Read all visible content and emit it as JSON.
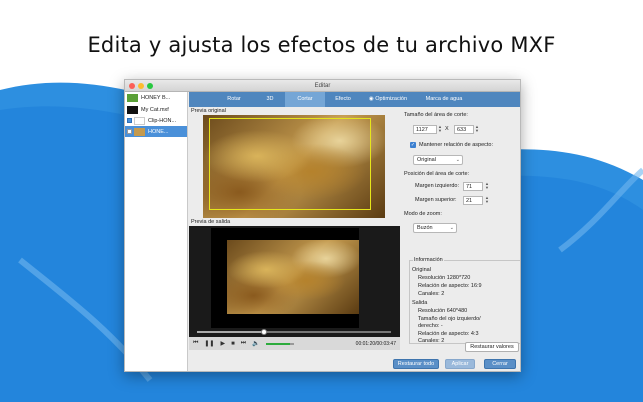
{
  "headline": "Edita y ajusta los efectos de tu archivo MXF",
  "window": {
    "title": "Editar",
    "files": [
      {
        "name": "HONEY B...",
        "checked": false,
        "selected": false
      },
      {
        "name": "My Cat.mxf",
        "checked": false,
        "selected": false
      },
      {
        "name": "Clip-HON...",
        "checked": true,
        "selected": false
      },
      {
        "name": "HONE...",
        "checked": false,
        "selected": true
      }
    ],
    "tabs": [
      "Rotar",
      "3D",
      "Cortar",
      "Efecto",
      "Optimización",
      "Marca de agua"
    ],
    "active_tab": "Cortar",
    "preview_original_label": "Previa original",
    "preview_output_label": "Previa de salida",
    "time_display": "00:01:20/00:03:47",
    "crop": {
      "size_label": "Tamaño del área de corte:",
      "width": "1127",
      "x_sep": "X",
      "height": "633",
      "keep_ratio_label": "Mantener relación de aspecto:",
      "keep_ratio_checked": true,
      "ratio_option": "Original",
      "position_label": "Posición del área de corte:",
      "margin_left_label": "Margen izquierdo:",
      "margin_left": "71",
      "margin_top_label": "Margen superior:",
      "margin_top": "21",
      "zoom_label": "Modo de zoom:",
      "zoom_option": "Buzón"
    },
    "info": {
      "title": "Información",
      "original_heading": "Original",
      "original_resolution": "Resolución 1280*720",
      "original_ratio": "Relación de aspecto: 16:9",
      "original_channels": "Canales: 2",
      "output_heading": "Salida",
      "output_resolution": "Resolución 640*480",
      "eye_size_line1": "Tamaño del ojo izquierdo/",
      "eye_size_line2": "derecho: -",
      "output_ratio": "Relación de aspecto: 4:3",
      "output_channels": "Canales: 2"
    },
    "buttons": {
      "restore_values": "Restaurar valores",
      "restore_all": "Restaurar todo",
      "apply": "Aplicar",
      "cancel": "Cerrar"
    }
  },
  "colors": {
    "accent_blue": "#4f86be",
    "active_tab": "#75a6d6",
    "crop_frame": "#e6e61a",
    "progress_green": "#2cab3c"
  }
}
